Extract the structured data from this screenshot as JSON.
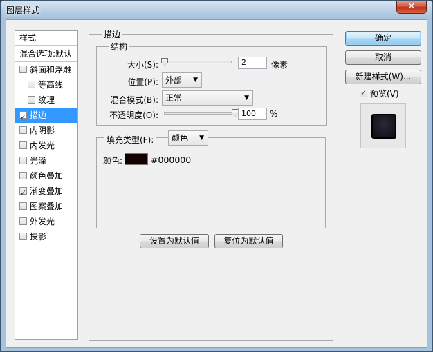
{
  "window": {
    "title": "图层样式",
    "close_glyph": "✕"
  },
  "styles_panel": {
    "header": "样式",
    "blend_default": "混合选项:默认",
    "items": [
      {
        "label": "斜面和浮雕",
        "checked": false
      },
      {
        "label": "等高线",
        "checked": false,
        "sub": true
      },
      {
        "label": "纹理",
        "checked": false,
        "sub": true
      },
      {
        "label": "描边",
        "checked": true,
        "selected": true
      },
      {
        "label": "内阴影",
        "checked": false
      },
      {
        "label": "内发光",
        "checked": false
      },
      {
        "label": "光泽",
        "checked": false
      },
      {
        "label": "颜色叠加",
        "checked": false
      },
      {
        "label": "渐变叠加",
        "checked": true
      },
      {
        "label": "图案叠加",
        "checked": false
      },
      {
        "label": "外发光",
        "checked": false
      },
      {
        "label": "投影",
        "checked": false
      }
    ]
  },
  "stroke": {
    "group_title": "描边",
    "structure_title": "结构",
    "size_label": "大小(S):",
    "size_value": "2",
    "size_unit": "像素",
    "size_slider_fraction": 0.0,
    "position_label": "位置(P):",
    "position_value": "外部",
    "blend_label": "混合模式(B):",
    "blend_value": "正常",
    "opacity_label": "不透明度(O):",
    "opacity_value": "100",
    "opacity_unit": "%",
    "opacity_slider_fraction": 1.0,
    "fill_type_label": "填充类型(F):",
    "fill_type_value": "颜色",
    "color_label": "颜色:",
    "color_hex": "#000000",
    "color_swatch": "#150000"
  },
  "buttons": {
    "ok": "确定",
    "cancel": "取消",
    "new_style": "新建样式(W)...",
    "preview_label": "预览(V)",
    "preview_checked": true,
    "set_default": "设置为默认值",
    "reset_default": "复位为默认值"
  },
  "icons": {
    "checkbox": "checkbox-icon",
    "dropdown": "chevron-down-icon",
    "close": "close-icon"
  }
}
